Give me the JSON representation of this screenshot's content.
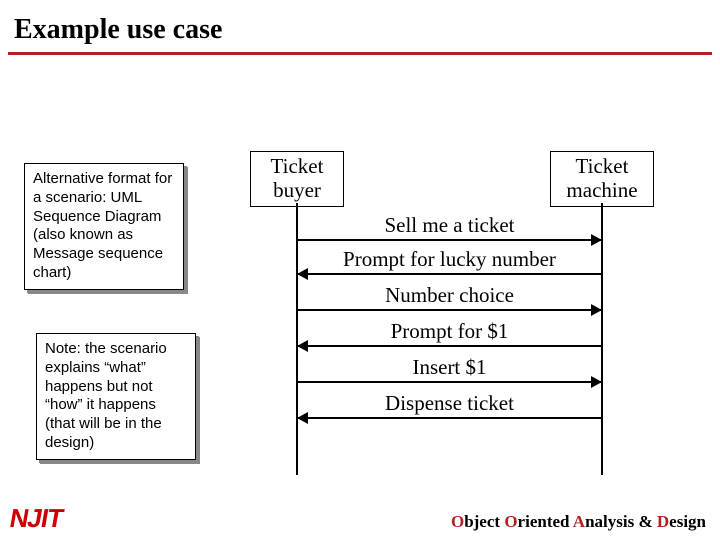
{
  "title": "Example use case",
  "note1": "Alternative format for a scenario: UML Sequence Diagram (also known as Message sequence chart)",
  "note2": "Note: the scenario explains “what” happens but not “how” it happens (that will be in the design)",
  "participants": {
    "left": "Ticket buyer",
    "right": "Ticket machine"
  },
  "messages": {
    "m1": "Sell me a ticket",
    "m2": "Prompt for lucky number",
    "m3": "Number choice",
    "m4": "Prompt for $1",
    "m5": "Insert $1",
    "m6": "Dispense ticket"
  },
  "footer": {
    "o1": "O",
    "w1": "bject ",
    "o2": "O",
    "w2": "riented ",
    "a": "A",
    "w3": "nalysis & ",
    "d": "D",
    "w4": "esign"
  },
  "logo": "NJIT"
}
